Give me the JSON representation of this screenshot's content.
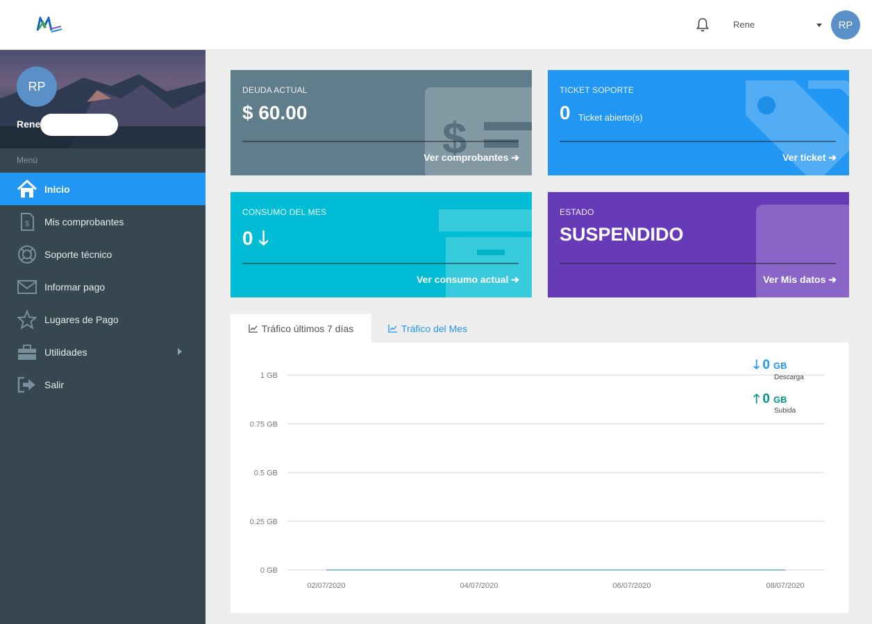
{
  "topbar": {
    "username": "Rene",
    "avatar_initials": "RP",
    "icons": [
      "bell-icon",
      "caret-down-icon"
    ]
  },
  "sidebar": {
    "avatar_initials": "RP",
    "username": "Rene",
    "menu_label": "Menú",
    "items": [
      {
        "label": "Inicio",
        "icon": "home-icon",
        "active": true
      },
      {
        "label": "Mis comprobantes",
        "icon": "receipt-icon"
      },
      {
        "label": "Soporte técnico",
        "icon": "lifebuoy-icon"
      },
      {
        "label": "Informar pago",
        "icon": "envelope-icon"
      },
      {
        "label": "Lugares de Pago",
        "icon": "star-icon"
      },
      {
        "label": "Utilidades",
        "icon": "toolbox-icon",
        "has_submenu": true
      },
      {
        "label": "Salir",
        "icon": "logout-icon"
      }
    ]
  },
  "cards": {
    "deuda": {
      "title": "DEUDA ACTUAL",
      "value": "$ 60.00",
      "link": "Ver comprobantes",
      "color": "#607d8b"
    },
    "ticket": {
      "title": "TICKET SOPORTE",
      "value": "0",
      "value_suffix": "Ticket abierto(s)",
      "link": "Ver ticket",
      "color": "#2196f3"
    },
    "consumo": {
      "title": "CONSUMO DEL MES",
      "value": "0",
      "link": "Ver consumo actual",
      "color": "#00bcd4"
    },
    "estado": {
      "title": "ESTADO",
      "value": "SUSPENDIDO",
      "link": "Ver Mis datos",
      "color": "#673ab7"
    }
  },
  "tabs": [
    {
      "label": "Tráfico últimos 7 días",
      "active": true
    },
    {
      "label": "Tráfico del Mes",
      "active": false
    }
  ],
  "chart_data": {
    "type": "line",
    "x": [
      "02/07/2020",
      "04/07/2020",
      "06/07/2020",
      "08/07/2020"
    ],
    "ytick_labels": [
      "1 GB",
      "0.75 GB",
      "0.5 GB",
      "0.25 GB",
      "0 GB"
    ],
    "ylim": [
      0,
      1
    ],
    "grid": true,
    "series": [
      {
        "name": "Descarga",
        "values": [
          0,
          0,
          0,
          0
        ],
        "color": "#2196f3"
      },
      {
        "name": "Subida",
        "values": [
          0,
          0,
          0,
          0
        ],
        "color": "#009688"
      }
    ]
  },
  "legend": {
    "download": {
      "value": "0",
      "unit": "GB",
      "label": "Descarga",
      "color": "#2196f3"
    },
    "upload": {
      "value": "0",
      "unit": "GB",
      "label": "Subida",
      "color": "#009688"
    }
  }
}
